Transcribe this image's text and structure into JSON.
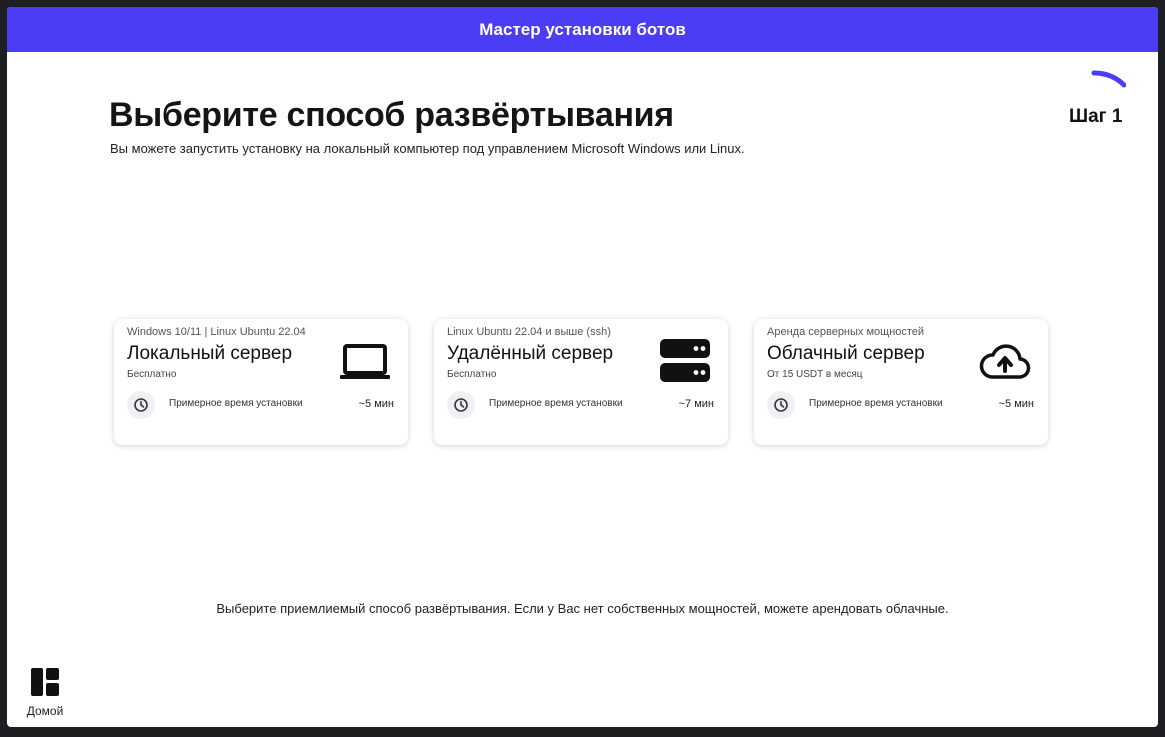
{
  "window": {
    "title": "Мастер установки ботов"
  },
  "step": {
    "label": "Шаг 1"
  },
  "header": {
    "title": "Выберите способ развёртывания",
    "subtitle": "Вы можете запустить установку на локальный компьютер под управлением Microsoft Windows или Linux."
  },
  "cards": [
    {
      "os": "Windows 10/11 | Linux Ubuntu 22.04",
      "title": "Локальный сервер",
      "price": "Бесплатно",
      "time_label": "Примерное время установки",
      "time_value": "~5 мин",
      "icon": "laptop-icon"
    },
    {
      "os": "Linux Ubuntu 22.04 и выше (ssh)",
      "title": "Удалённый сервер",
      "price": "Бесплатно",
      "time_label": "Примерное время установки",
      "time_value": "~7 мин",
      "icon": "server-icon"
    },
    {
      "os": "Аренда серверных мощностей",
      "title": "Облачный сервер",
      "price": "От 15 USDT в месяц",
      "time_label": "Примерное время установки",
      "time_value": "~5 мин",
      "icon": "cloud-upload-icon"
    }
  ],
  "hint": "Выберите приемлиемый способ развёртывания. Если у Вас нет собственных мощностей, можете арендовать облачные.",
  "nav": {
    "home_label": "Домой"
  },
  "colors": {
    "accent": "#4b3cf5",
    "background": "#ffffff",
    "frame": "#1e1f22"
  }
}
